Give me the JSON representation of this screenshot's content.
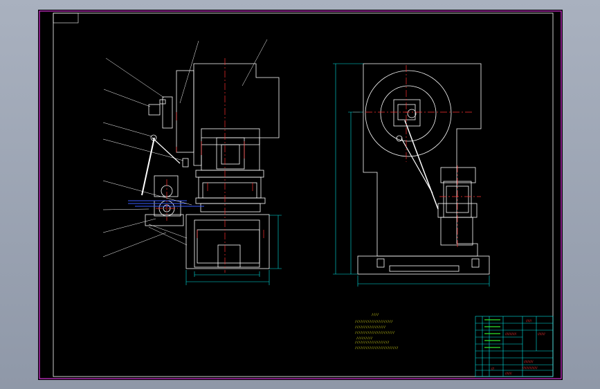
{
  "drawing": {
    "colors": {
      "background": "#000000",
      "frame_outer": "#ff3bff",
      "frame_inner": "#ffffff",
      "body_lines": "#ffffff",
      "center_lines": "#ff3030",
      "dimension_lines": "#00e5e5",
      "leaders": "#ffffff",
      "title_block": "#00e5e5",
      "notes_text": "#f2f21a",
      "green_text": "#2ee62e",
      "blue_part": "#3a5cff"
    },
    "technical_notes": [
      "////",
      "/////////////////////",
      "/////////////////",
      "//////////////////////",
      "/////////",
      "///////////////////",
      "////////////////////////"
    ],
    "title_block": {
      "cells": [
        "//////",
        "////////////",
        "////////",
        "//////////",
        "///",
        "////////////////",
        "///////"
      ]
    }
  }
}
